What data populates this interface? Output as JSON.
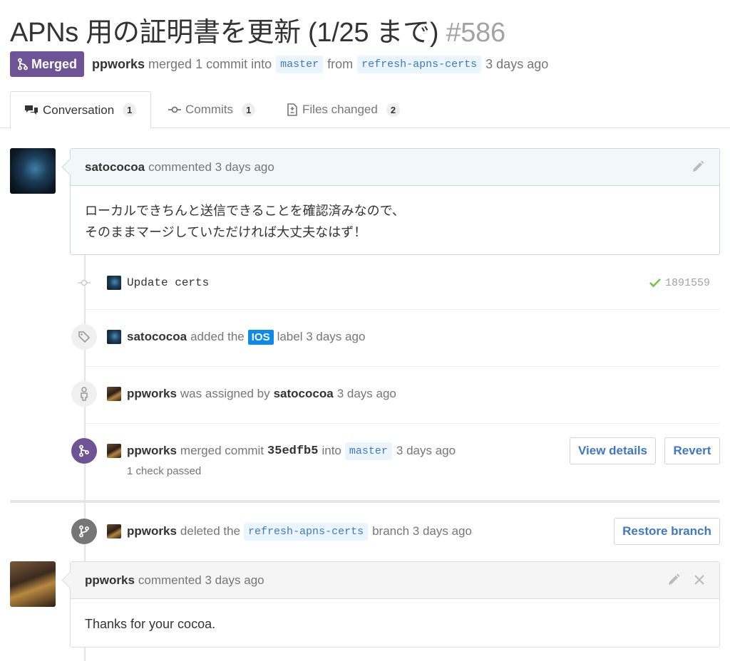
{
  "pr": {
    "title": "APNs 用の証明書を更新 (1/25 まで)",
    "number": "#586",
    "state": "Merged",
    "author": "ppworks",
    "merged_text": "merged 1 commit into",
    "base_branch": "master",
    "from_text": "from",
    "head_branch": "refresh-apns-certs",
    "time": "3 days ago"
  },
  "tabs": [
    {
      "label": "Conversation",
      "count": "1",
      "icon": "comment-discussion-icon"
    },
    {
      "label": "Commits",
      "count": "1",
      "icon": "git-commit-icon"
    },
    {
      "label": "Files changed",
      "count": "2",
      "icon": "diff-icon"
    }
  ],
  "comment1": {
    "author": "satococoa",
    "action": "commented 3 days ago",
    "line1": "ローカルできちんと送信できることを確認済みなので、",
    "line2": "そのままマージしていただければ大丈夫なはず！"
  },
  "commit_event": {
    "message": "Update certs",
    "sha": "1891559",
    "status_color": "#6cc644"
  },
  "label_event": {
    "actor": "satococoa",
    "text1": "added the",
    "label": "IOS",
    "label_color": "#0e8aeb",
    "text2": "label 3 days ago"
  },
  "assign_event": {
    "assignee": "ppworks",
    "text1": "was assigned by",
    "assigner": "satococoa",
    "time": "3 days ago"
  },
  "merge_event": {
    "actor": "ppworks",
    "text1": "merged commit",
    "sha": "35edfb5",
    "text2": "into",
    "branch": "master",
    "time": "3 days ago",
    "checks": "1 check passed",
    "view_details_label": "View details",
    "revert_label": "Revert",
    "badge_color": "#6e5494"
  },
  "delete_event": {
    "actor": "ppworks",
    "text1": "deleted the",
    "branch": "refresh-apns-certs",
    "text2": "branch 3 days ago",
    "restore_label": "Restore branch"
  },
  "comment2": {
    "author": "ppworks",
    "action": "commented 3 days ago",
    "body": "Thanks for your cocoa."
  }
}
